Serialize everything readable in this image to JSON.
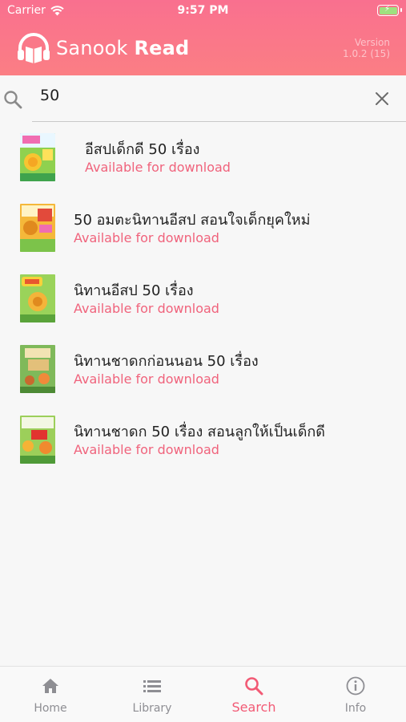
{
  "status_bar": {
    "carrier": "Carrier",
    "time": "9:57 PM"
  },
  "header": {
    "brand_light": "Sanook",
    "brand_bold": "Read",
    "version_label": "Version",
    "version_number": "1.0.2 (15)"
  },
  "search": {
    "query": "50",
    "placeholder": ""
  },
  "results": [
    {
      "title": "อีสปเด็กดี 50 เรื่อง",
      "status": "Available for download"
    },
    {
      "title": "50 อมตะนิทานอีสป สอนใจเด็กยุคใหม่",
      "status": "Available for download"
    },
    {
      "title": "นิทานอีสป 50 เรื่อง",
      "status": "Available for download"
    },
    {
      "title": "นิทานชาดกก่อนนอน 50 เรื่อง",
      "status": "Available for download"
    },
    {
      "title": "นิทานชาดก 50 เรื่อง สอนลูกให้เป็นเด็กดี",
      "status": "Available for download"
    }
  ],
  "tabs": [
    {
      "label": "Home"
    },
    {
      "label": "Library"
    },
    {
      "label": "Search"
    },
    {
      "label": "Info"
    }
  ],
  "colors": {
    "accent": "#f25a75",
    "header_top": "#f9708f",
    "header_bottom": "#fb7e84",
    "available_text": "#f0637c"
  }
}
